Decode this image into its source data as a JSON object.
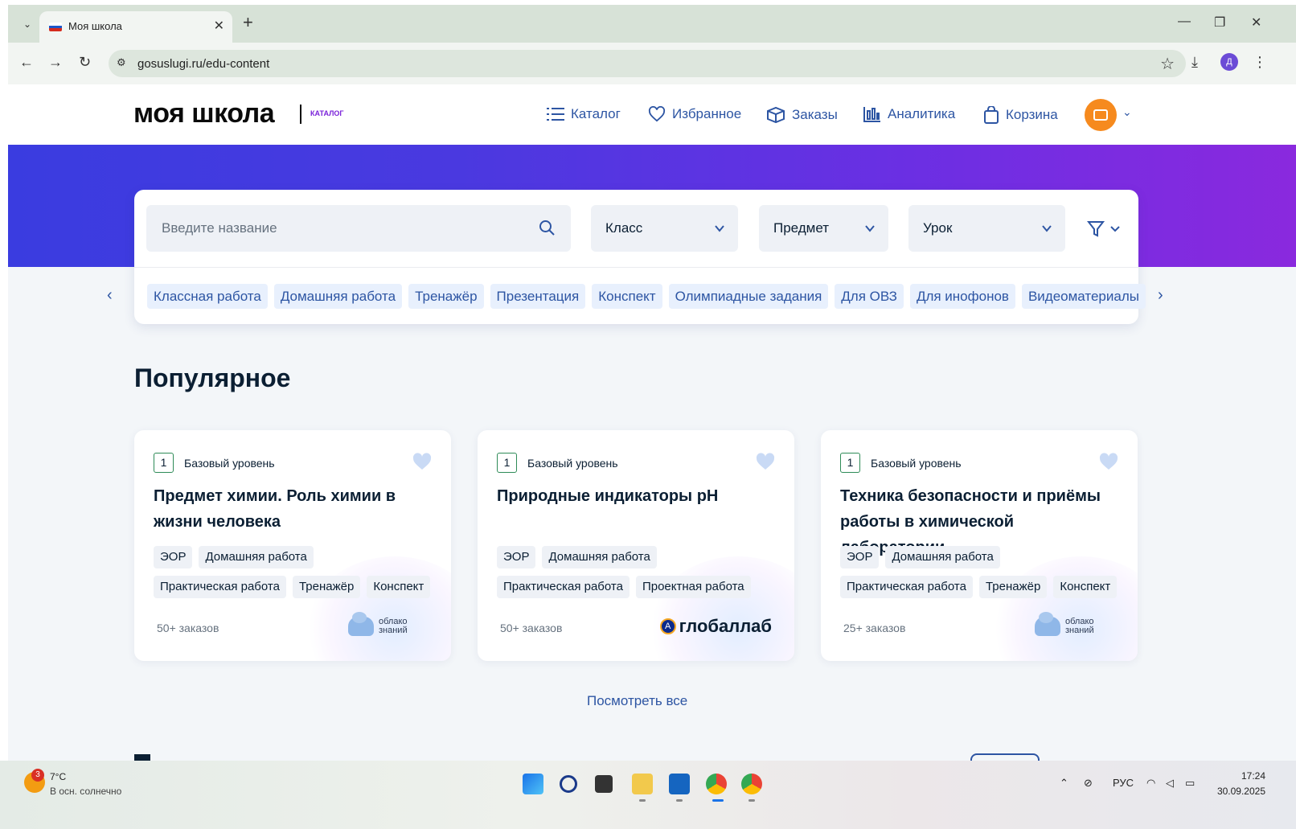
{
  "browser": {
    "tab_title": "Моя школа",
    "url": "gosuslugi.ru/edu-content",
    "profile_initial": "Д"
  },
  "site": {
    "logo": "моя школа",
    "logo_sub": "КАТАЛОГ",
    "nav": [
      {
        "label": "Каталог",
        "icon": "list-icon"
      },
      {
        "label": "Избранное",
        "icon": "heart-icon"
      },
      {
        "label": "Заказы",
        "icon": "box-icon"
      },
      {
        "label": "Аналитика",
        "icon": "chart-icon"
      },
      {
        "label": "Корзина",
        "icon": "bag-icon"
      }
    ]
  },
  "search": {
    "placeholder": "Введите название",
    "class_label": "Класс",
    "subject_label": "Предмет",
    "lesson_label": "Урок"
  },
  "chips": [
    "Классная работа",
    "Домашняя работа",
    "Тренажёр",
    "Презентация",
    "Конспект",
    "Олимпиадные задания",
    "Для ОВЗ",
    "Для инофонов",
    "Видеоматериалы"
  ],
  "popular": {
    "title": "Популярное",
    "see_all": "Посмотреть все",
    "cards": [
      {
        "grade": "1",
        "level": "Базовый уровень",
        "title": "Предмет химии. Роль химии в жизни человека",
        "tags": [
          "ЭОР",
          "Домашняя работа",
          "Практическая работа",
          "Тренажёр",
          "Конспект"
        ],
        "orders": "50+ заказов",
        "provider": "облако знаний"
      },
      {
        "grade": "1",
        "level": "Базовый уровень",
        "title": "Природные индикаторы pH",
        "tags": [
          "ЭОР",
          "Домашняя работа",
          "Практическая работа",
          "Проектная работа"
        ],
        "orders": "50+ заказов",
        "provider": "глобаллаб"
      },
      {
        "grade": "1",
        "level": "Базовый уровень",
        "title": "Техника безопасности и приёмы работы в химической лаборатории",
        "tags": [
          "ЭОР",
          "Домашняя работа",
          "Практическая работа",
          "Тренажёр",
          "Конспект"
        ],
        "orders": "25+ заказов",
        "provider": "облако знаний"
      }
    ]
  },
  "taskbar": {
    "weather_badge": "3",
    "temperature": "7°C",
    "weather_desc": "В осн. солнечно",
    "lang": "РУС",
    "time": "17:24",
    "date": "30.09.2025"
  },
  "colors": {
    "accent": "#2d55a3",
    "hero_start": "#3a3ce0",
    "hero_end": "#8a29de",
    "avatar": "#f68a1e"
  }
}
